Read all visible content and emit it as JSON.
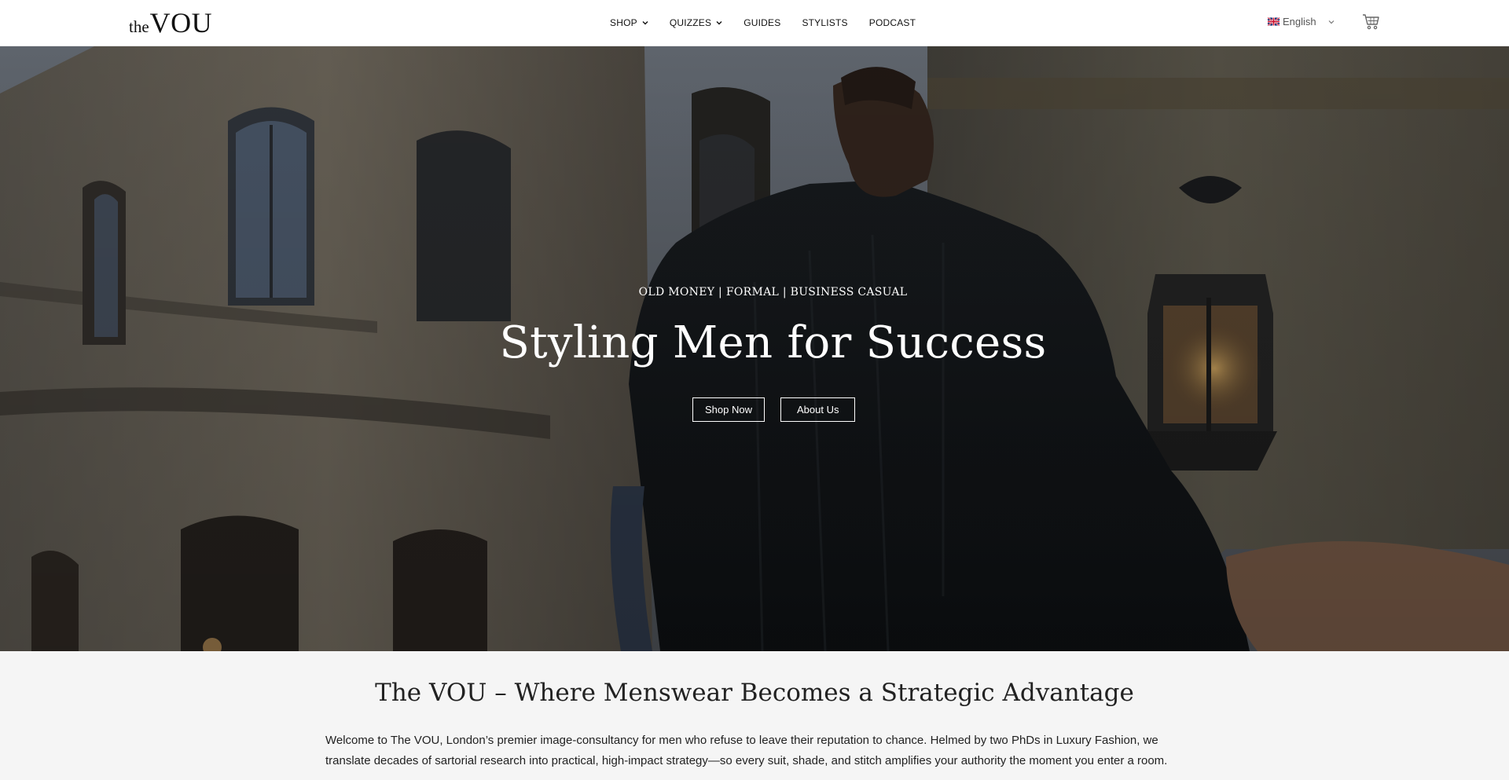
{
  "header": {
    "logo_small": "the",
    "logo_big": "VOU",
    "nav": [
      {
        "label": "SHOP",
        "has_dropdown": true
      },
      {
        "label": "QUIZZES",
        "has_dropdown": true
      },
      {
        "label": "GUIDES",
        "has_dropdown": false
      },
      {
        "label": "STYLISTS",
        "has_dropdown": false
      },
      {
        "label": "PODCAST",
        "has_dropdown": false
      }
    ],
    "language": "English",
    "language_flag": "uk-flag-icon",
    "cart_icon": "cart-icon"
  },
  "hero": {
    "eyebrow": "OLD MONEY | FORMAL | BUSINESS CASUAL",
    "title": "Styling Men for Success",
    "primary_button": "Shop Now",
    "secondary_button": "About Us"
  },
  "intro": {
    "title": "The VOU – Where Menswear Becomes a Strategic Advantage",
    "text": "Welcome to The VOU, London’s premier image-consultancy for men who refuse to leave their reputation to chance. Helmed by two PhDs in Luxury Fashion, we translate decades of sartorial research into practical, high-impact strategy—so every suit, shade, and stitch amplifies your authority the moment you enter a room."
  },
  "colors": {
    "header_bg": "#ffffff",
    "section_bg": "#f5f5f5",
    "text_dark": "#222222",
    "hero_text": "#ffffff"
  }
}
